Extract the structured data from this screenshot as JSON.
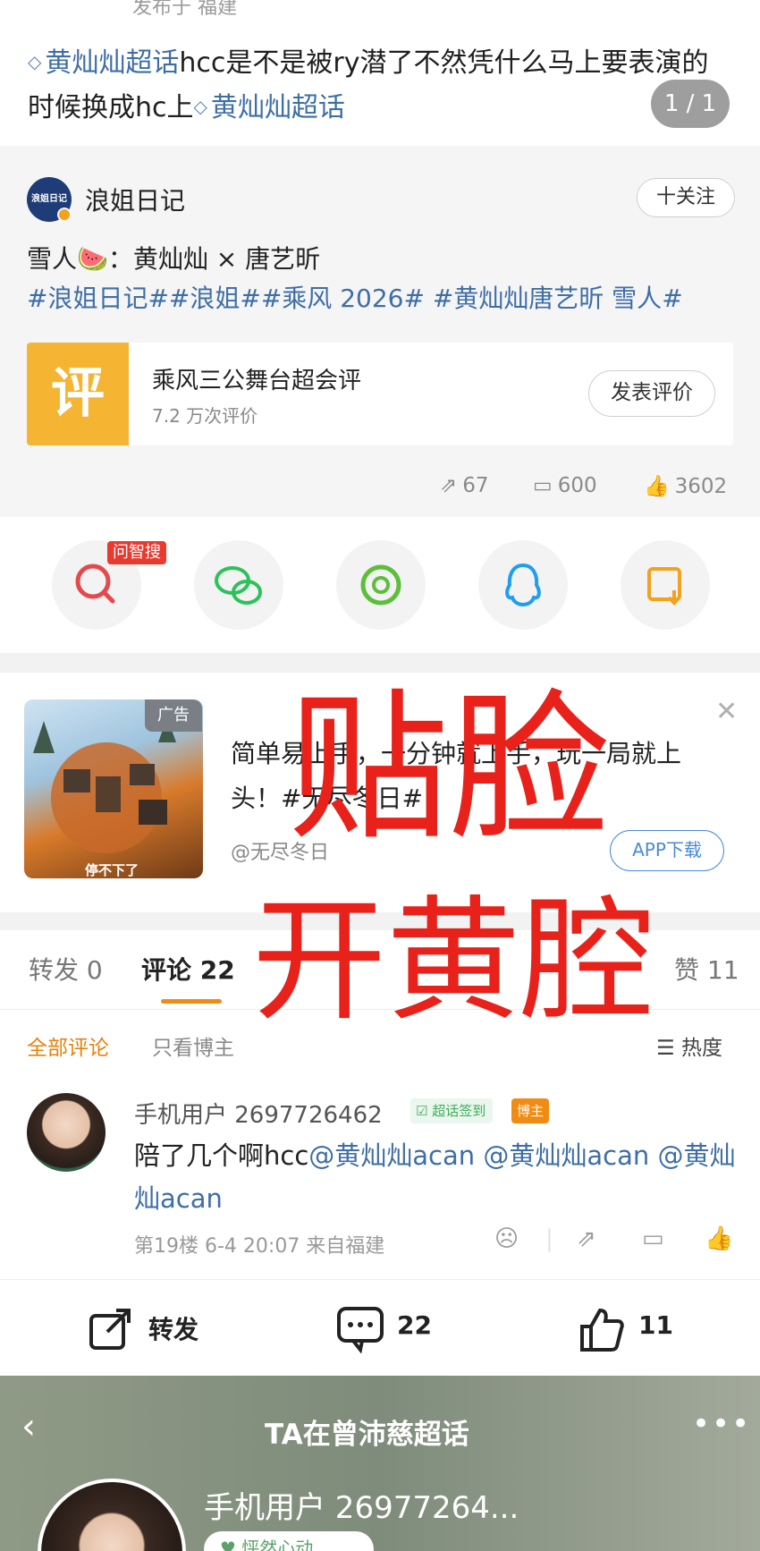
{
  "post": {
    "published": "发布于 福建",
    "topic_prefix": "黄灿灿超话",
    "body": "hcc是不是被ry潜了不然凭什么马上要表演的时候换成hc上",
    "topic_suffix": "黄灿灿超话",
    "page_counter": "1 / 1"
  },
  "repost": {
    "avatar_text": "浪姐日记",
    "name": "浪姐日记",
    "follow_label": "十关注",
    "line1_prefix": "雪人",
    "line1_emoji": "🍉",
    "line1_rest": "：黄灿灿 × 唐艺昕",
    "line2": "#浪姐日记##浪姐##乘风 2026# #黄灿灿唐艺昕 雪人#",
    "rate_icon": "评",
    "rate_title": "乘风三公舞台超会评",
    "rate_sub": "7.2 万次评价",
    "rate_button": "发表评价",
    "stats": {
      "reposts": "67",
      "comments": "600",
      "likes": "3602"
    }
  },
  "share": {
    "ai_badge": "问智搜",
    "items": [
      "search-ai-icon",
      "wechat-icon",
      "moments-icon",
      "qq-icon",
      "save-image-icon"
    ],
    "colors": {
      "search": "#e5484d",
      "wechat": "#2dc15a",
      "moments": "#5dbe3c",
      "qq": "#1f9df0",
      "save": "#f2a21d"
    }
  },
  "ad": {
    "label": "广告",
    "thumb_caption": "停不下了",
    "text": "简单易上手，一分钟就上手，玩一局就上头！#无尽冬日#",
    "source": "@无尽冬日",
    "download": "APP下载"
  },
  "overlay": {
    "line1": "贴脸",
    "line2": "开黄腔"
  },
  "tabs": {
    "repost": "转发",
    "repost_count": "0",
    "comment": "评论",
    "comment_count": "22",
    "like": "赞",
    "like_count": "11",
    "filter_all": "全部评论",
    "filter_author": "只看博主",
    "sort": "热度"
  },
  "comment": {
    "name": "手机用户 2697726462",
    "badge1": "超话签到",
    "badge2": "博主",
    "text_prefix": "陪了几个啊hcc",
    "mention1": "@黄灿灿acan",
    "mention2": "@黄灿灿acan",
    "mention3": "@黄灿灿acan",
    "meta": "第19楼 6-4 20:07 来自福建"
  },
  "action_bar": {
    "repost": "转发",
    "comment_count": "22",
    "like_count": "11"
  },
  "banner": {
    "title": "TA在曾沛慈超话",
    "name": "手机用户 26977264...",
    "pill": "怦然心动"
  }
}
